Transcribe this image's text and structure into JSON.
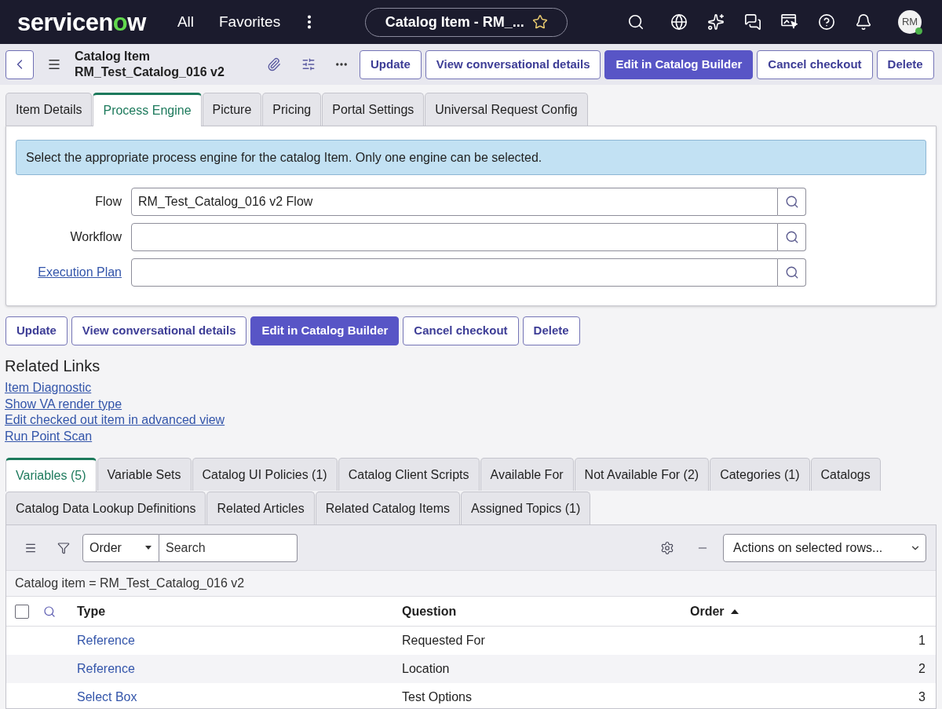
{
  "top_nav": {
    "logo": "servicenow",
    "menus": [
      "All",
      "Favorites"
    ],
    "context_pill": {
      "title": "Catalog Item - RM_...",
      "starred": false
    },
    "avatar": {
      "initials": "RM",
      "online": true
    }
  },
  "form_header": {
    "record_type": "Catalog Item",
    "record_name": "RM_Test_Catalog_016 v2",
    "buttons": [
      {
        "label": "Update",
        "primary": false
      },
      {
        "label": "View conversational details",
        "primary": false
      },
      {
        "label": "Edit in Catalog Builder",
        "primary": true
      },
      {
        "label": "Cancel checkout",
        "primary": false
      },
      {
        "label": "Delete",
        "primary": false
      }
    ]
  },
  "form_tabs": [
    {
      "label": "Item Details",
      "selected": false
    },
    {
      "label": "Process Engine",
      "selected": true
    },
    {
      "label": "Picture",
      "selected": false
    },
    {
      "label": "Pricing",
      "selected": false
    },
    {
      "label": "Portal Settings",
      "selected": false
    },
    {
      "label": "Universal Request Config",
      "selected": false
    }
  ],
  "process_engine": {
    "info_message": "Select the appropriate process engine for the catalog Item. Only one engine can be selected.",
    "fields": [
      {
        "label": "Flow",
        "label_link": false,
        "value": "RM_Test_Catalog_016 v2 Flow"
      },
      {
        "label": "Workflow",
        "label_link": false
      },
      {
        "label": "Execution Plan",
        "label_link": true
      }
    ]
  },
  "form_buttons": [
    {
      "label": "Update",
      "primary": false
    },
    {
      "label": "View conversational details",
      "primary": false
    },
    {
      "label": "Edit in Catalog Builder",
      "primary": true
    },
    {
      "label": "Cancel checkout",
      "primary": false
    },
    {
      "label": "Delete",
      "primary": false
    }
  ],
  "related_links": {
    "title": "Related Links",
    "links": [
      "Item Diagnostic",
      "Show VA render type",
      "Edit checked out item in advanced view",
      "Run Point Scan"
    ]
  },
  "related_list_tabs": {
    "tab_rows": [
      {
        "tabs": [
          {
            "label": "Variables (5)",
            "selected": true
          },
          {
            "label": "Variable Sets",
            "selected": false
          },
          {
            "label": "Catalog UI Policies (1)",
            "selected": false
          },
          {
            "label": "Catalog Client Scripts",
            "selected": false
          },
          {
            "label": "Available For",
            "selected": false
          },
          {
            "label": "Not Available For (2)",
            "selected": false
          },
          {
            "label": "Categories (1)",
            "selected": false
          },
          {
            "label": "Catalogs",
            "selected": false
          }
        ]
      },
      {
        "tabs": [
          {
            "label": "Catalog Data Lookup Definitions",
            "selected": false
          },
          {
            "label": "Related Articles",
            "selected": false
          },
          {
            "label": "Related Catalog Items",
            "selected": false
          },
          {
            "label": "Assigned Topics (1)",
            "selected": false
          }
        ]
      }
    ]
  },
  "variables_list": {
    "field_select": "Order",
    "search_placeholder": "Search",
    "actions_select": "Actions on selected rows...",
    "breadcrumb": "Catalog item = RM_Test_Catalog_016 v2",
    "select_all_checked": false,
    "columns": [
      {
        "label": "Type",
        "sorted": false
      },
      {
        "label": "Question",
        "sorted": false
      },
      {
        "label": "Order",
        "sorted": true
      }
    ],
    "rows": [
      {
        "type": "Reference",
        "question": "Requested For",
        "order": "1"
      },
      {
        "type": "Reference",
        "question": "Location",
        "order": "2"
      },
      {
        "type": "Select Box",
        "question": "Test Options",
        "order": "3"
      }
    ]
  }
}
